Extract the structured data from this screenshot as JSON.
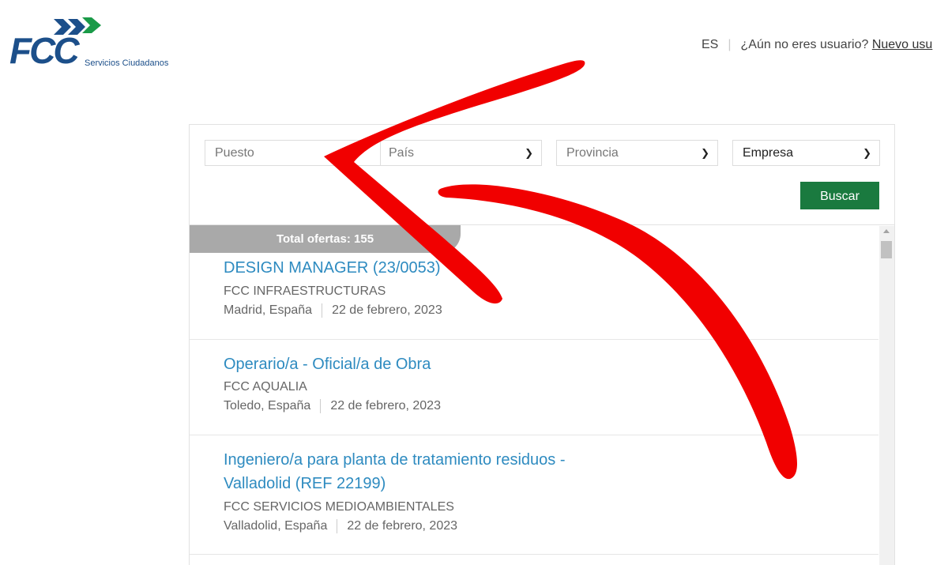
{
  "brand": {
    "logo_text": "FCC",
    "logo_subtitle": "Servicios Ciudadanos",
    "colors": {
      "blue": "#1c4f8a",
      "green": "#1a9a48"
    }
  },
  "header": {
    "language": "ES",
    "prompt": "¿Aún no eres usuario?",
    "register_link": "Nuevo usu"
  },
  "search": {
    "puesto_placeholder": "Puesto",
    "pais_value": "País",
    "provincia_value": "Provincia",
    "empresa_value": "Empresa",
    "button_label": "Buscar"
  },
  "results": {
    "total_label": "Total ofertas: 155",
    "jobs": [
      {
        "title": "DESIGN MANAGER (23/0053)",
        "company": "FCC INFRAESTRUCTURAS",
        "location": "Madrid, España",
        "date": "22 de febrero, 2023"
      },
      {
        "title": "Operario/a - Oficial/a de Obra",
        "company": "FCC AQUALIA",
        "location": "Toledo, España",
        "date": "22 de febrero, 2023"
      },
      {
        "title_line1": "Ingeniero/a para planta de tratamiento residuos -",
        "title_line2": "Valladolid (REF 22199)",
        "company": "FCC SERVICIOS MEDIOAMBIENTALES",
        "location": "Valladolid, España",
        "date": "22 de febrero, 2023"
      }
    ]
  },
  "colors": {
    "accent_green": "#1a7a3f",
    "link_blue": "#2e8bc0",
    "badge_grey": "#a9a9a9",
    "arrow_red": "#f10000"
  },
  "icons": [
    "chevron-down-icon",
    "scroll-up-icon",
    "red-arrow-annotation"
  ]
}
